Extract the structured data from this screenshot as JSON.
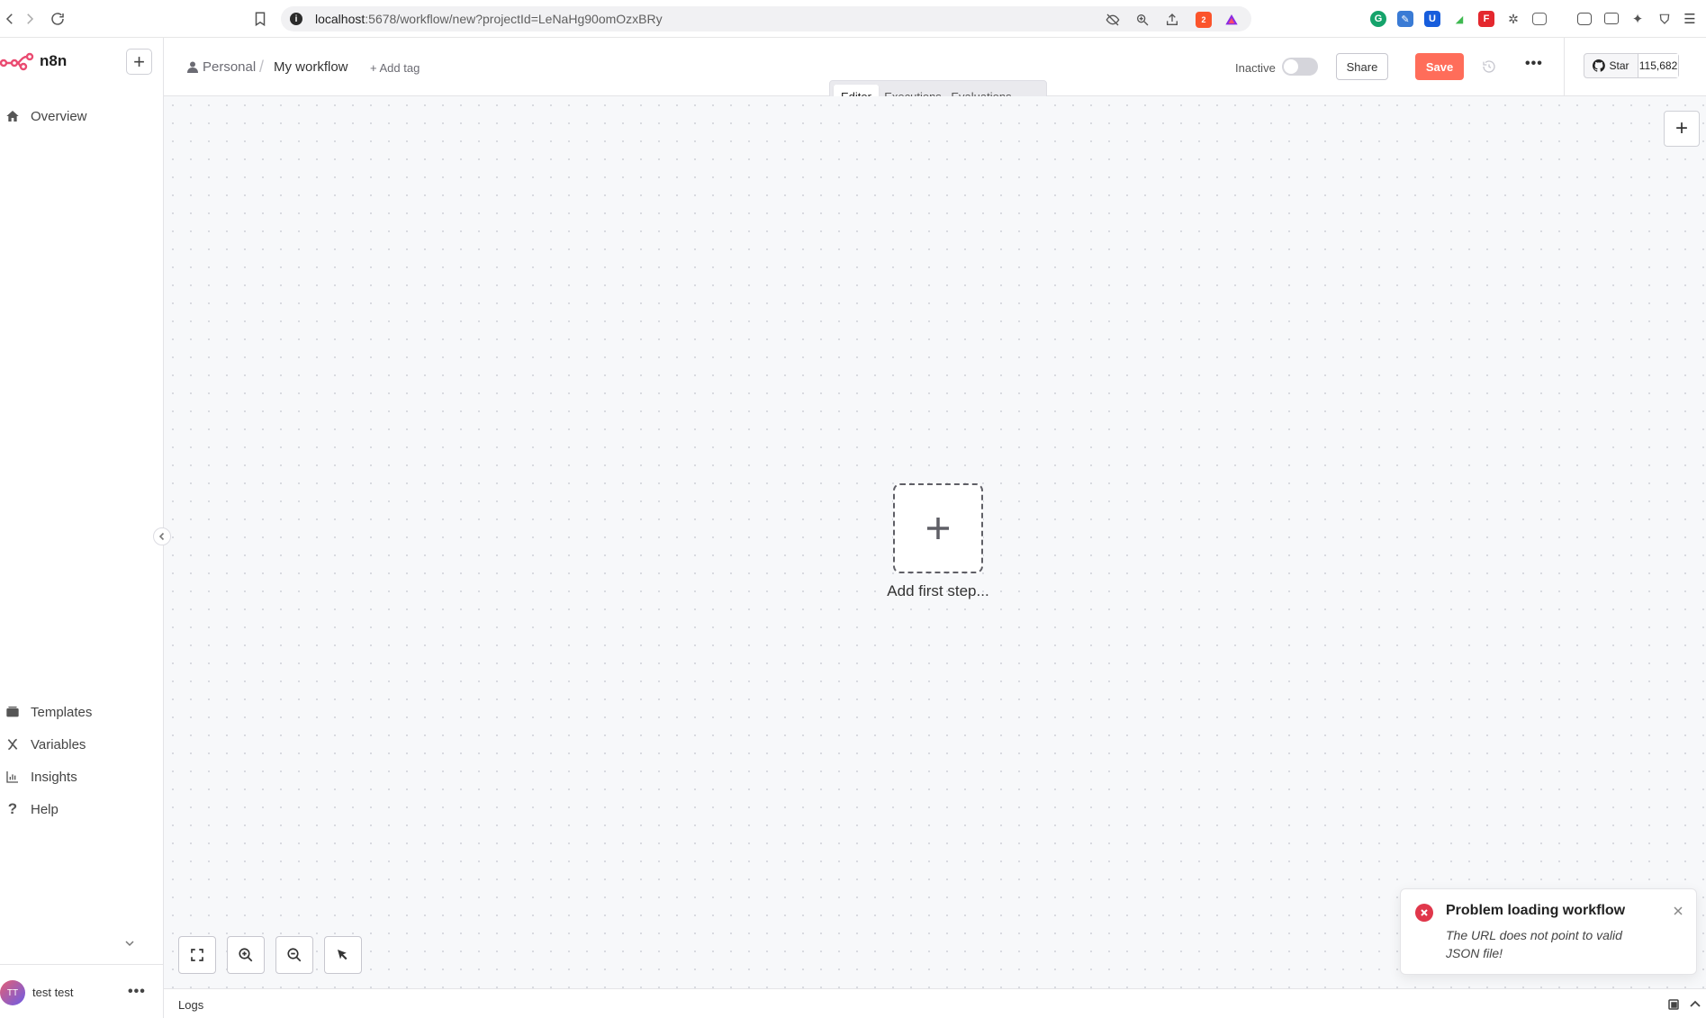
{
  "browser": {
    "url_host": "localhost",
    "url_path": ":5678/workflow/new?projectId=LeNaHg90omOzxBRy",
    "brave_badge": "2"
  },
  "sidebar": {
    "brand": "n8n",
    "new_button": "+",
    "items": [
      {
        "label": "Overview",
        "icon": "home-icon"
      },
      {
        "label": "Templates",
        "icon": "templates-icon"
      },
      {
        "label": "Variables",
        "icon": "variables-icon"
      },
      {
        "label": "Insights",
        "icon": "insights-icon"
      },
      {
        "label": "Help",
        "icon": "help-icon"
      }
    ],
    "user": {
      "initials": "TT",
      "name": "test test",
      "more": "•••"
    }
  },
  "header": {
    "project": "Personal",
    "separator": "/",
    "workflow_name": "My workflow",
    "add_tag": "+ Add tag",
    "tabs": [
      {
        "label": "Editor",
        "active": true
      },
      {
        "label": "Executions",
        "active": false
      },
      {
        "label": "Evaluations",
        "active": false
      }
    ],
    "status_label": "Inactive",
    "share_label": "Share",
    "save_label": "Save",
    "more": "•••",
    "github": {
      "star_label": "Star",
      "count": "115,682"
    }
  },
  "canvas": {
    "add_node": "+",
    "first_step_label": "Add first step..."
  },
  "toast": {
    "title": "Problem loading workflow",
    "message": "The URL does not point to valid JSON file!"
  },
  "logs": {
    "label": "Logs"
  },
  "colors": {
    "accent": "#ff6d5a",
    "error": "#e0374b",
    "canvas_bg": "#f7f8fa"
  }
}
